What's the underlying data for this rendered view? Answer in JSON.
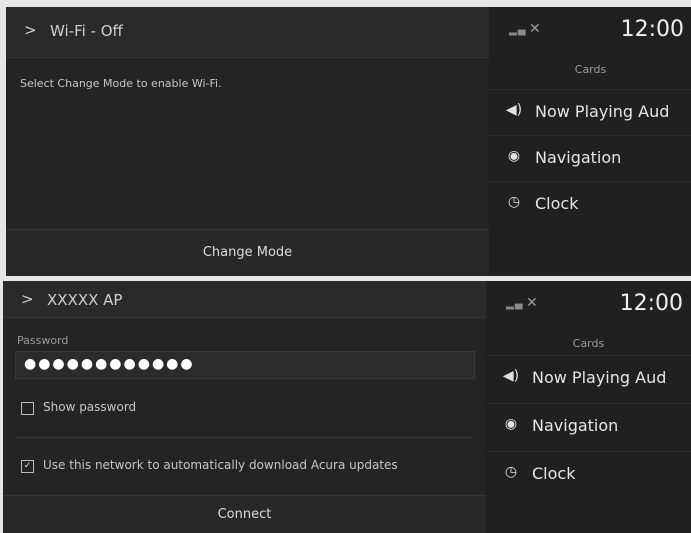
{
  "screen1": {
    "header": {
      "title": "Wi-Fi - Off"
    },
    "message": "Select Change Mode to enable Wi-Fi.",
    "button": "Change Mode",
    "status": {
      "time": "12:00"
    },
    "cards": {
      "label": "Cards",
      "items": [
        {
          "icon": "speaker-icon",
          "label": "Now Playing Aud"
        },
        {
          "icon": "navigation-icon",
          "label": "Navigation"
        },
        {
          "icon": "clock-icon",
          "label": "Clock"
        }
      ]
    }
  },
  "screen2": {
    "header": {
      "title": "XXXXX AP"
    },
    "password": {
      "label": "Password",
      "value": "●●●●●●●●●●●●"
    },
    "show_password": {
      "label": "Show password",
      "checked": false
    },
    "auto_update": {
      "label": "Use this network to automatically download Acura updates",
      "checked": true
    },
    "button": "Connect",
    "status": {
      "time": "12:00"
    },
    "cards": {
      "label": "Cards",
      "items": [
        {
          "icon": "speaker-icon",
          "label": "Now Playing Aud"
        },
        {
          "icon": "navigation-icon",
          "label": "Navigation"
        },
        {
          "icon": "clock-icon",
          "label": "Clock"
        }
      ]
    }
  }
}
